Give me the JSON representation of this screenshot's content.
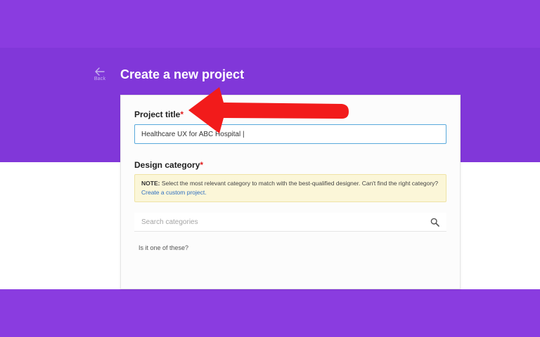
{
  "header": {
    "back_label": "Back",
    "page_title": "Create a new project"
  },
  "form": {
    "project_title": {
      "label": "Project title",
      "required_mark": "*",
      "value": "Healthcare UX for ABC Hospital |"
    },
    "design_category": {
      "label": "Design category",
      "required_mark": "*",
      "note_prefix": "NOTE:",
      "note_text": " Select the most relevant category to match with the best-qualified designer. Can't find the right category? ",
      "note_link": "Create a custom project.",
      "search_placeholder": "Search categories",
      "suggestion_label": "Is it one of these?"
    }
  },
  "colors": {
    "brand_purple": "#8137d9",
    "annotation_red": "#f21b1b",
    "input_focus_border": "#59a9db",
    "note_background": "#fbf6d8",
    "link": "#2f6fc0"
  },
  "icons": {
    "back": "arrow-left-icon",
    "search": "search-icon",
    "annotation": "red-arrow-annotation"
  }
}
